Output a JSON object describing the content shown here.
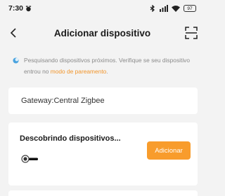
{
  "status": {
    "time": "7:30",
    "battery": "97"
  },
  "header": {
    "title": "Adicionar dispositivo"
  },
  "info": {
    "text": "Pesquisando dispositivos próximos. Verifique se seu dispositivo entrou no ",
    "link": "modo de pareamento",
    "end": "."
  },
  "gateway": {
    "label": "Gateway:Central Zigbee"
  },
  "discover": {
    "title": "Descobrindo dispositivos...",
    "add_label": "Adicionar"
  },
  "colors": {
    "accent": "#f89c2c",
    "background": "#f3f3f3"
  },
  "icons": [
    "alarm-icon",
    "bluetooth-icon",
    "signal-icon",
    "wifi-icon",
    "battery-icon",
    "back-icon",
    "scan-icon",
    "search-info-icon",
    "device-icon"
  ]
}
